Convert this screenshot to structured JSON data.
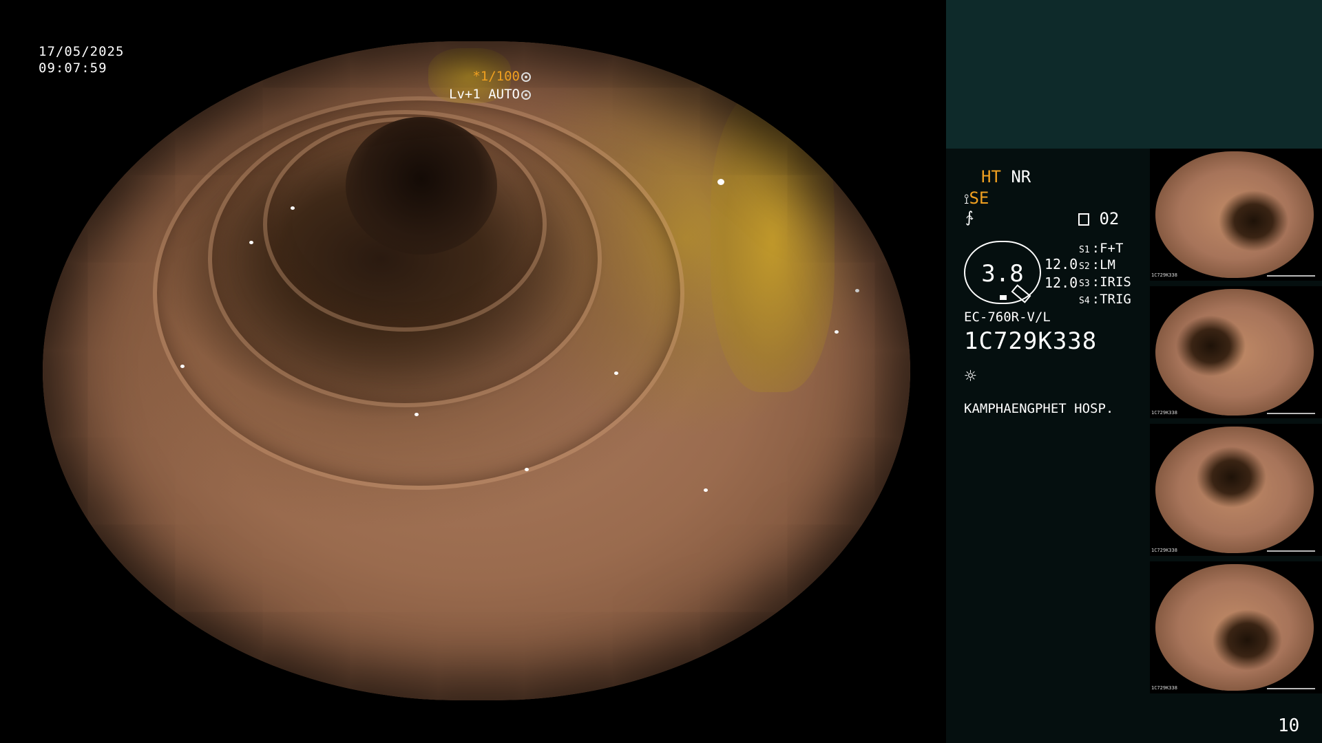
{
  "overlay": {
    "date": "17/05/2025",
    "time": "09:07:59",
    "shutter": "*1/100",
    "level": "Lv+1 AUTO"
  },
  "panel": {
    "ht": "HT",
    "nr": "NR",
    "se": "SE",
    "memory_slot": "02",
    "gauge_value": "3.8",
    "value_a": "12.0",
    "value_b": "12.0",
    "switches": [
      {
        "key": "S1",
        "label": "F+T"
      },
      {
        "key": "S2",
        "label": "LM"
      },
      {
        "key": "S3",
        "label": "IRIS"
      },
      {
        "key": "S4",
        "label": "TRIG"
      }
    ],
    "scope_model": "EC-760R-V/L",
    "scope_serial": "1C729K338",
    "hospital": "KAMPHAENGPHET HOSP.",
    "page_number": "10"
  },
  "thumbnails": [
    {
      "caption": "1C729K338"
    },
    {
      "caption": "1C729K338"
    },
    {
      "caption": "1C729K338"
    },
    {
      "caption": "1C729K338"
    }
  ],
  "colors": {
    "accent": "#f0a020",
    "panel_top": "#0e2a2a",
    "panel_bg": "#050f0f"
  }
}
